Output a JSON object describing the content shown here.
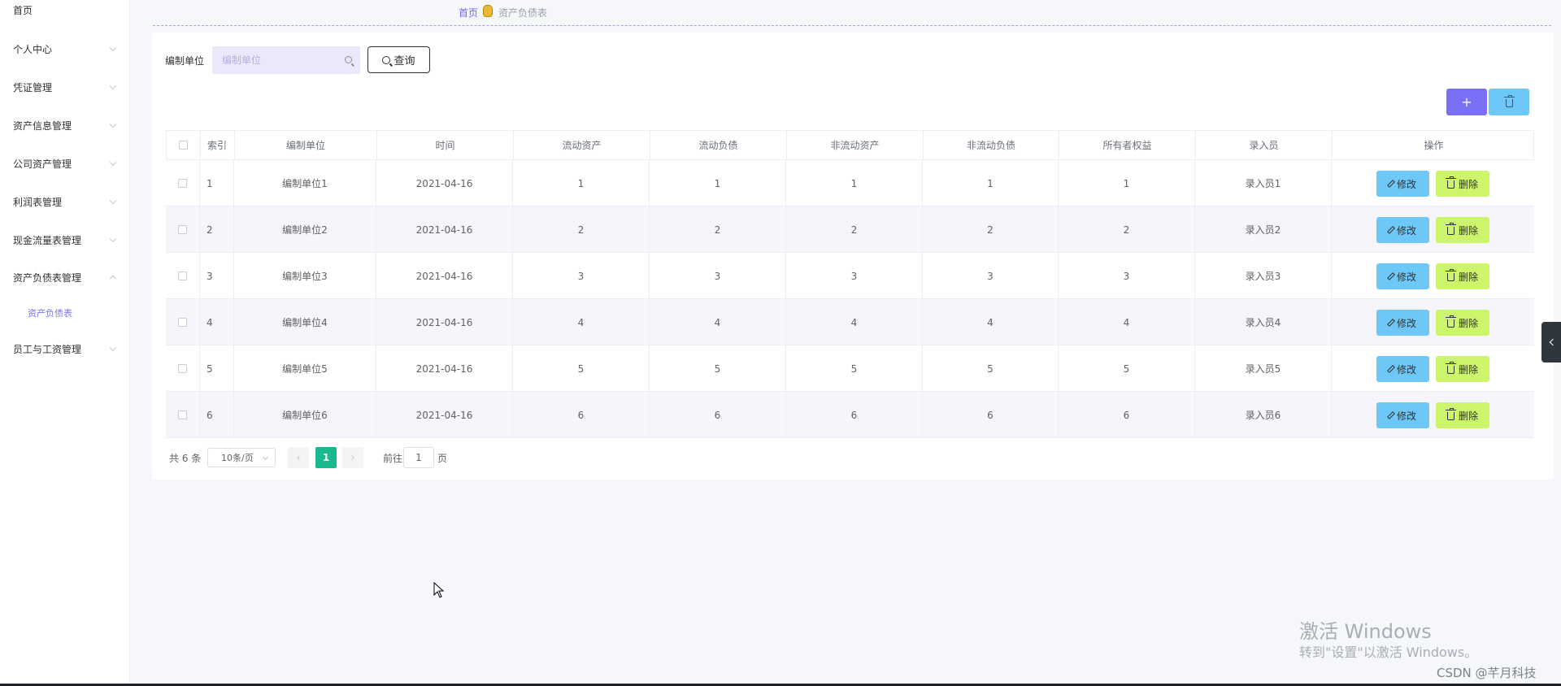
{
  "sidebar": {
    "items": [
      {
        "label": "首页",
        "chevron": "none"
      },
      {
        "label": "个人中心",
        "chevron": "down"
      },
      {
        "label": "凭证管理",
        "chevron": "down"
      },
      {
        "label": "资产信息管理",
        "chevron": "down"
      },
      {
        "label": "公司资产管理",
        "chevron": "down"
      },
      {
        "label": "利润表管理",
        "chevron": "down"
      },
      {
        "label": "现金流量表管理",
        "chevron": "down"
      },
      {
        "label": "资产负债表管理",
        "chevron": "up"
      },
      {
        "label": "员工与工资管理",
        "chevron": "down"
      }
    ],
    "sub_item": "资产负债表"
  },
  "breadcrumb": {
    "home": "首页",
    "current": "资产负债表"
  },
  "search": {
    "label": "编制单位",
    "placeholder": "编制单位",
    "value": "",
    "button_label": "查询"
  },
  "actions": {
    "add_symbol": "+"
  },
  "table": {
    "headers": [
      "索引",
      "编制单位",
      "时间",
      "流动资产",
      "流动负债",
      "非流动资产",
      "非流动负债",
      "所有者权益",
      "录入员",
      "操作"
    ],
    "rows": [
      {
        "index": "1",
        "unit": "编制单位1",
        "time": "2021-04-16",
        "ca": "1",
        "cl": "1",
        "nca": "1",
        "ncl": "1",
        "equity": "1",
        "clerk": "录入员1"
      },
      {
        "index": "2",
        "unit": "编制单位2",
        "time": "2021-04-16",
        "ca": "2",
        "cl": "2",
        "nca": "2",
        "ncl": "2",
        "equity": "2",
        "clerk": "录入员2"
      },
      {
        "index": "3",
        "unit": "编制单位3",
        "time": "2021-04-16",
        "ca": "3",
        "cl": "3",
        "nca": "3",
        "ncl": "3",
        "equity": "3",
        "clerk": "录入员3"
      },
      {
        "index": "4",
        "unit": "编制单位4",
        "time": "2021-04-16",
        "ca": "4",
        "cl": "4",
        "nca": "4",
        "ncl": "4",
        "equity": "4",
        "clerk": "录入员4"
      },
      {
        "index": "5",
        "unit": "编制单位5",
        "time": "2021-04-16",
        "ca": "5",
        "cl": "5",
        "nca": "5",
        "ncl": "5",
        "equity": "5",
        "clerk": "录入员5"
      },
      {
        "index": "6",
        "unit": "编制单位6",
        "time": "2021-04-16",
        "ca": "6",
        "cl": "6",
        "nca": "6",
        "ncl": "6",
        "equity": "6",
        "clerk": "录入员6"
      }
    ],
    "edit_label": "修改",
    "delete_label": "删除"
  },
  "pagination": {
    "total_text": "共 6 条",
    "page_size": "10条/页",
    "current_page": "1",
    "goto_label": "前往",
    "goto_value": "1",
    "page_suffix": "页"
  },
  "watermark": {
    "line1": "激活 Windows",
    "line2": "转到\"设置\"以激活 Windows。",
    "credit": "CSDN @芊月科技"
  },
  "colors": {
    "accent": "#7a70f7",
    "edit_button": "#6ec8f7",
    "delete_button": "#cdf56b",
    "active_page": "#19b98f"
  }
}
